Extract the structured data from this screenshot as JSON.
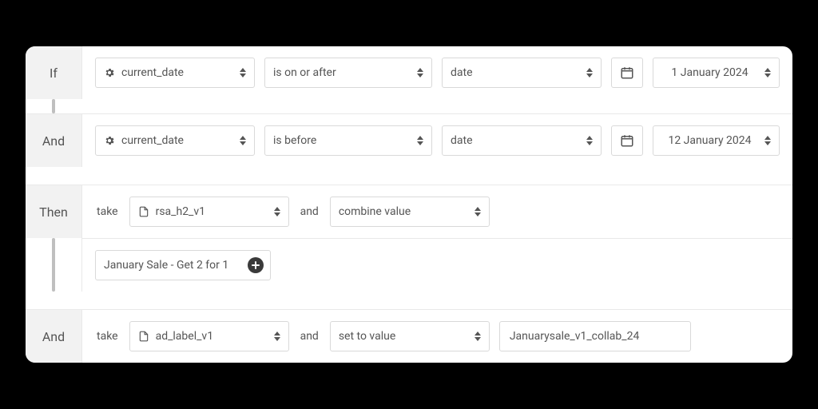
{
  "rows": [
    {
      "label": "If",
      "field": "current_date",
      "operator": "is on or after",
      "valueType": "date",
      "dateValue": "1 January 2024"
    },
    {
      "label": "And",
      "field": "current_date",
      "operator": "is before",
      "valueType": "date",
      "dateValue": "12 January 2024"
    },
    {
      "label": "Then",
      "takeWord": "take",
      "takeField": "rsa_h2_v1",
      "andWord": "and",
      "action": "combine value"
    },
    {
      "combineValue": "January Sale - Get 2 for 1"
    },
    {
      "label": "And",
      "takeWord": "take",
      "takeField": "ad_label_v1",
      "andWord": "and",
      "action": "set to value",
      "setValue": "Januarysale_v1_collab_24"
    }
  ]
}
